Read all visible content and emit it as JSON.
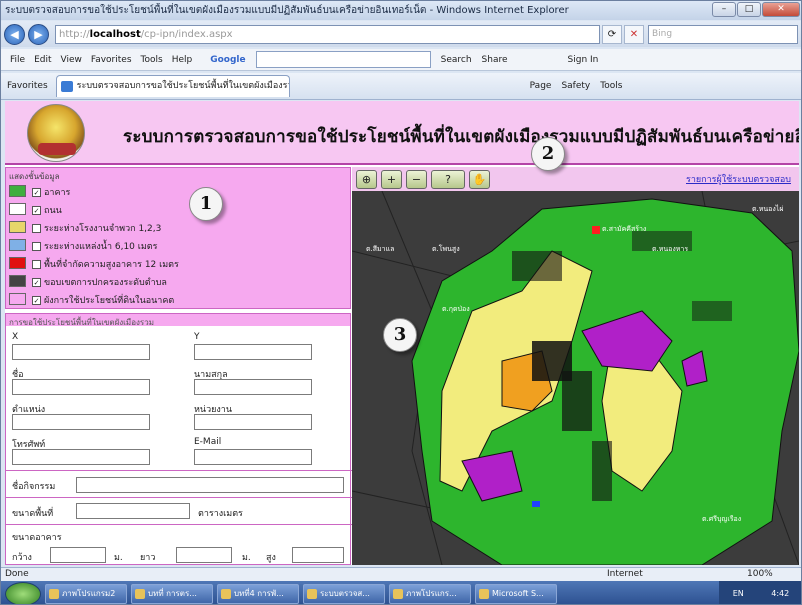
{
  "window": {
    "title": "ระบบตรวจสอบการขอใช้ประโยชน์พื้นที่ในเขตผังเมืองรวมแบบมีปฏิสัมพันธ์บนเครือข่ายอินเทอร์เน็ต - Windows Internet Explorer",
    "min_label": "–",
    "max_label": "□",
    "close_label": "✕"
  },
  "addressbar": {
    "back_label": "◀",
    "fwd_label": "▶",
    "url_host": "localhost",
    "url_path": "/cp-ipn/index.aspx",
    "search_placeholder": "Bing"
  },
  "menubar": {
    "items": [
      "File",
      "Edit",
      "View",
      "Favorites",
      "Tools",
      "Help"
    ],
    "google_label": "Google",
    "search_btn": "Search",
    "share_btn": "Share",
    "signin": "Sign In"
  },
  "favbar": {
    "favorites": "Favorites",
    "tab_title": "ระบบตรวจสอบการขอใช้ประโยชน์พื้นที่ในเขตผังเมืองรวม...",
    "page_menu": "Page",
    "safety_menu": "Safety",
    "tools_menu": "Tools"
  },
  "banner": {
    "title": "ระบบการตรวจสอบการขอใช้ประโยชน์พื้นที่ในเขตผังเมืองรวมแบบมีปฏิสัมพันธ์บนเครือข่ายอินเทอร์เน็ต"
  },
  "legend": {
    "header": "แสดงชั้นข้อมูล",
    "items": [
      {
        "label": "อาคาร",
        "checked": true,
        "color": "#3fae3f"
      },
      {
        "label": "ถนน",
        "checked": true,
        "color": "#ffffff"
      },
      {
        "label": "ระยะห่างโรงงานจำพวก 1,2,3",
        "checked": false,
        "color": "#e7d66a"
      },
      {
        "label": "ระยะห่างแหล่งน้ำ 6,10 เมตร",
        "checked": false,
        "color": "#7fb0e6"
      },
      {
        "label": "พื้นที่จำกัดความสูงอาคาร 12 เมตร",
        "checked": false,
        "color": "#e01010"
      },
      {
        "label": "ขอบเขตการปกครองระดับตำบล",
        "checked": true,
        "color": "#444444"
      },
      {
        "label": "ผังการใช้ประโยชน์ที่ดินในอนาคต",
        "checked": true,
        "color": "#f6a9ef"
      }
    ]
  },
  "form": {
    "header": "การขอใช้ประโยชน์พื้นที่ในเขตผังเมืองรวม",
    "x_label": "X",
    "y_label": "Y",
    "name_label": "ชื่อ",
    "surname_label": "นามสกุล",
    "position_label": "ตำแหน่ง",
    "agency_label": "หน่วยงาน",
    "phone_label": "โทรศัพท์",
    "email_label": "E-Mail",
    "activity_label": "ชื่อกิจกรรม",
    "area_label": "ขนาดพื้นที่",
    "area_unit": "ตารางเมตร",
    "building_label": "ขนาดอาคาร",
    "width_label": "กว้าง",
    "m1": "ม.",
    "length_label": "ยาว",
    "m2": "ม.",
    "height_label": "สูง"
  },
  "maptoolbar": {
    "tools": [
      {
        "icon": "zoom-extent-icon",
        "glyph": "⊕"
      },
      {
        "icon": "zoom-in-icon",
        "glyph": "+"
      },
      {
        "icon": "zoom-out-icon",
        "glyph": "−"
      },
      {
        "icon": "identify-icon",
        "glyph": "?"
      },
      {
        "icon": "pan-icon",
        "glyph": "✋"
      }
    ],
    "link": "รายการผู้ใช้ระบบตรวจสอบ"
  },
  "map": {
    "place_labels": [
      "ต.สีมาแล",
      "ต.โพนสูง",
      "ต.หนองหาร",
      "ต.กุดป่อง",
      "ต.สามัคคีสร้าง",
      "ต.หนองไผ่",
      "ต.ศรีบุญเรือง"
    ]
  },
  "callouts": [
    "1",
    "2",
    "3"
  ],
  "statusbar": {
    "left": "Done",
    "zone": "Internet",
    "zoom": "100%"
  },
  "taskbar": {
    "items": [
      "ภาพโปรแกรม2",
      "บทที่ การตร...",
      "บทที่4 การพั...",
      "ระบบตรวจส...",
      "ภาพโปรแกร...",
      "Microsoft S..."
    ],
    "lang": "EN",
    "time": "4:42"
  }
}
